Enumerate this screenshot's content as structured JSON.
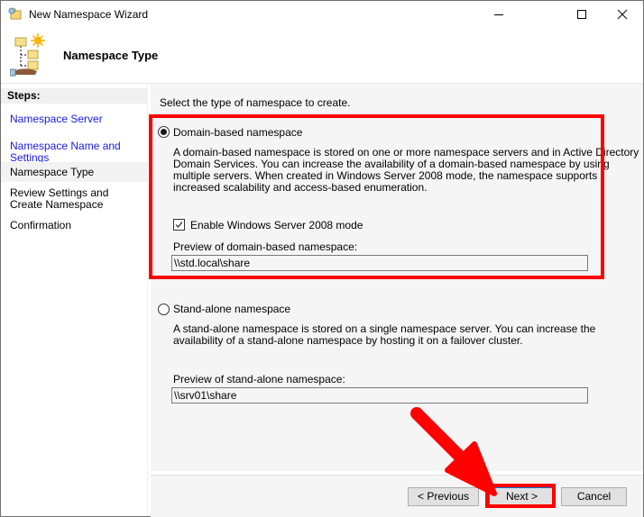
{
  "window": {
    "title": "New Namespace Wizard",
    "controls": {
      "minimize": "minimize-icon",
      "maximize": "maximize-icon",
      "close": "close-icon"
    }
  },
  "header": {
    "title": "Namespace Type",
    "icon": "namespace-tree-icon"
  },
  "sidebar": {
    "title": "Steps:",
    "steps": [
      {
        "label": "Namespace Server",
        "state": "completed"
      },
      {
        "label": "Namespace Name and Settings",
        "state": "completed"
      },
      {
        "label": "Namespace Type",
        "state": "current"
      },
      {
        "label": "Review Settings and Create Namespace",
        "state": "pending"
      },
      {
        "label": "Confirmation",
        "state": "pending"
      }
    ]
  },
  "main": {
    "instruction": "Select the type of namespace to create.",
    "domain_based": {
      "label": "Domain-based namespace",
      "selected": true,
      "description_lines": [
        "A domain-based namespace is stored on one or more namespace servers and in Active Directory",
        "Domain Services. You can increase the availability of a domain-based namespace by using",
        "multiple servers. When created in Windows Server 2008 mode, the namespace supports",
        "increased scalability and access-based enumeration."
      ],
      "mode_checkbox": {
        "label": "Enable Windows Server 2008 mode",
        "checked": true
      },
      "preview_label": "Preview of domain-based namespace:",
      "preview_value": "\\\\std.local\\share"
    },
    "standalone": {
      "label": "Stand-alone namespace",
      "selected": false,
      "description_lines": [
        "A stand-alone namespace is stored on a single namespace server. You can increase the",
        "availability of a stand-alone namespace by hosting it on a failover cluster."
      ],
      "preview_label": "Preview of stand-alone namespace:",
      "preview_value": "\\\\srv01\\share"
    }
  },
  "footer": {
    "previous": "< Previous",
    "next": "Next >",
    "cancel": "Cancel"
  },
  "annotations": {
    "highlight_color": "#ff0000",
    "highlights": [
      "domain-based-namespace-group",
      "next-button"
    ],
    "arrow_target": "next-button"
  }
}
